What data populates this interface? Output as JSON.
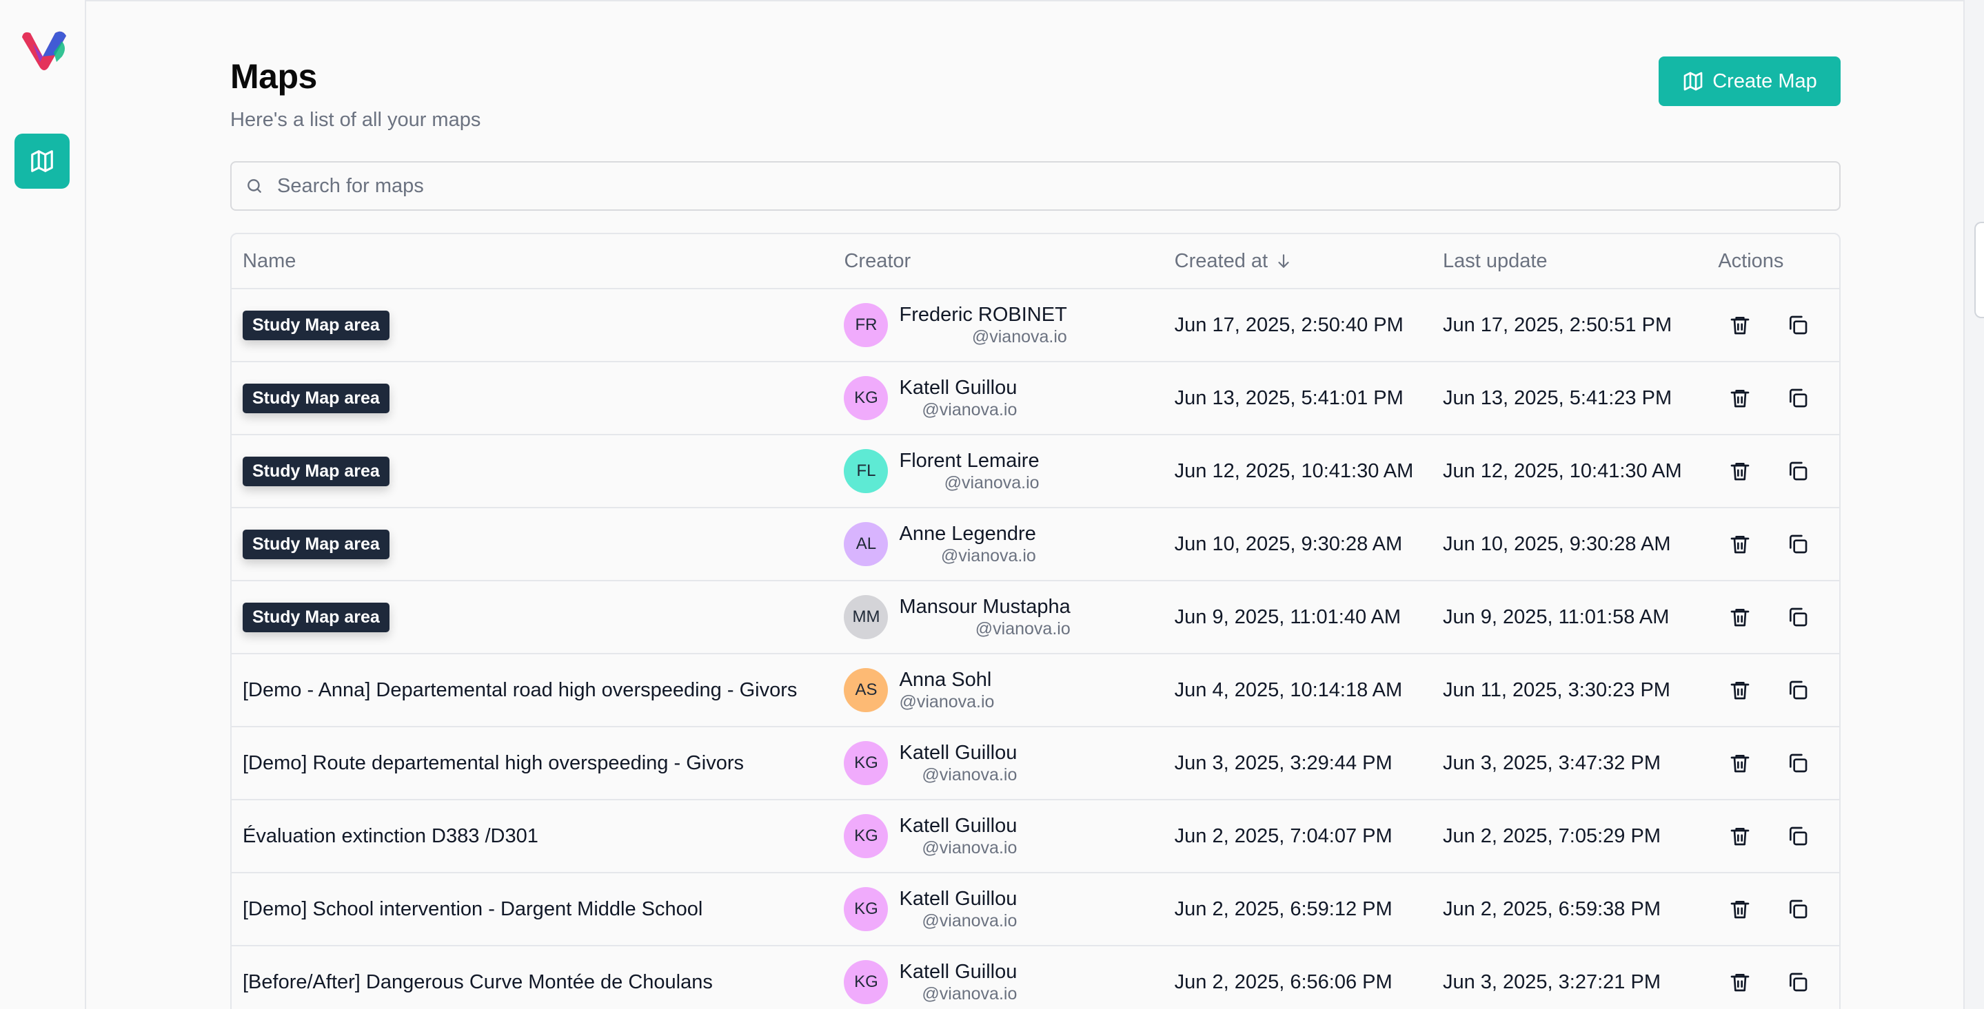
{
  "header": {
    "title": "Maps",
    "subtitle": "Here's a list of all your maps",
    "create_label": "Create Map"
  },
  "search": {
    "placeholder": "Search for maps",
    "value": ""
  },
  "table": {
    "columns": {
      "name": "Name",
      "creator": "Creator",
      "created": "Created at",
      "updated": "Last update",
      "actions": "Actions"
    },
    "rows": [
      {
        "name": "Study Map area",
        "tag": true,
        "initials": "FR",
        "avatar_color": "#f0abfc",
        "creator": "Frederic ROBINET",
        "domain": "@vianova.io",
        "created": "Jun 17, 2025, 2:50:40 PM",
        "updated": "Jun 17, 2025, 2:50:51 PM"
      },
      {
        "name": "Study Map area",
        "tag": true,
        "initials": "KG",
        "avatar_color": "#f0abfc",
        "creator": "Katell Guillou",
        "domain": "@vianova.io",
        "created": "Jun 13, 2025, 5:41:01 PM",
        "updated": "Jun 13, 2025, 5:41:23 PM"
      },
      {
        "name": "Study Map area",
        "tag": true,
        "initials": "FL",
        "avatar_color": "#5eead4",
        "creator": "Florent Lemaire",
        "domain": "@vianova.io",
        "created": "Jun 12, 2025, 10:41:30 AM",
        "updated": "Jun 12, 2025, 10:41:30 AM"
      },
      {
        "name": "Study Map area",
        "tag": true,
        "initials": "AL",
        "avatar_color": "#d8b4fe",
        "creator": "Anne Legendre",
        "domain": "@vianova.io",
        "created": "Jun 10, 2025, 9:30:28 AM",
        "updated": "Jun 10, 2025, 9:30:28 AM"
      },
      {
        "name": "Study Map area",
        "tag": true,
        "initials": "MM",
        "avatar_color": "#d4d4d8",
        "creator": "Mansour Mustapha",
        "domain": "@vianova.io",
        "created": "Jun 9, 2025, 11:01:40 AM",
        "updated": "Jun 9, 2025, 11:01:58 AM"
      },
      {
        "name": "[Demo - Anna] Departemental road high overspeeding - Givors",
        "tag": false,
        "initials": "AS",
        "avatar_color": "#fdba74",
        "creator": "Anna Sohl",
        "domain": "@vianova.io",
        "created": "Jun 4, 2025, 10:14:18 AM",
        "updated": "Jun 11, 2025, 3:30:23 PM"
      },
      {
        "name": "[Demo] Route departemental high overspeeding - Givors",
        "tag": false,
        "initials": "KG",
        "avatar_color": "#f0abfc",
        "creator": "Katell Guillou",
        "domain": "@vianova.io",
        "created": "Jun 3, 2025, 3:29:44 PM",
        "updated": "Jun 3, 2025, 3:47:32 PM"
      },
      {
        "name": "Évaluation extinction D383 /D301",
        "tag": false,
        "initials": "KG",
        "avatar_color": "#f0abfc",
        "creator": "Katell Guillou",
        "domain": "@vianova.io",
        "created": "Jun 2, 2025, 7:04:07 PM",
        "updated": "Jun 2, 2025, 7:05:29 PM"
      },
      {
        "name": "[Demo] School intervention - Dargent Middle School",
        "tag": false,
        "initials": "KG",
        "avatar_color": "#f0abfc",
        "creator": "Katell Guillou",
        "domain": "@vianova.io",
        "created": "Jun 2, 2025, 6:59:12 PM",
        "updated": "Jun 2, 2025, 6:59:38 PM"
      },
      {
        "name": "[Before/After] Dangerous Curve Montée de Choulans",
        "tag": false,
        "initials": "KG",
        "avatar_color": "#f0abfc",
        "creator": "Katell Guillou",
        "domain": "@vianova.io",
        "created": "Jun 2, 2025, 6:56:06 PM",
        "updated": "Jun 3, 2025, 3:27:21 PM"
      }
    ]
  },
  "icons": {
    "logo": "vianova-logo",
    "nav": "map-icon",
    "search": "search-icon",
    "sort": "arrow-down-icon",
    "delete": "trash-icon",
    "duplicate": "copy-icon"
  },
  "colors": {
    "accent": "#14b8a6",
    "tag_bg": "#1e293b"
  }
}
